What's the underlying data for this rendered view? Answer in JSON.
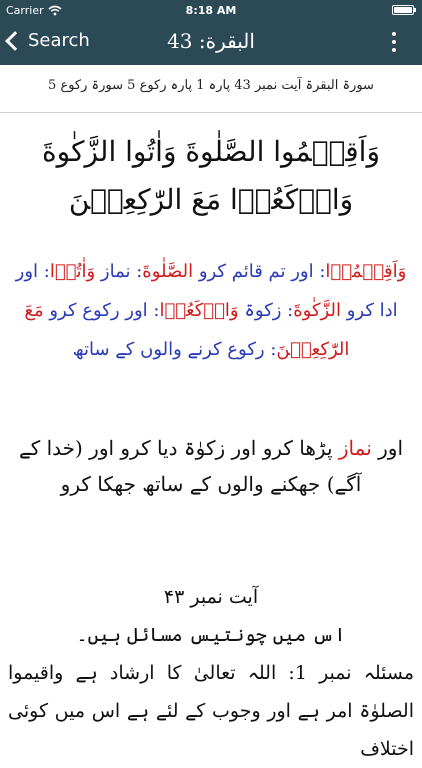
{
  "status": {
    "carrier": "Carrier",
    "time": "8:18 AM"
  },
  "nav": {
    "back_label": "Search",
    "title": "البقرة: 43"
  },
  "meta_line": "سورۃ البقرۃ آیت نمبر 43  پارہ 1 پارہ رکوع 5 سورۃ رکوع 5",
  "arabic_text": "وَاَقِيۡمُوا الصَّلٰوةَ وَاٰتُوا الزَّكٰوةَ وَارۡكَعُوۡا مَعَ الرّٰكِعِيۡنَ",
  "word_by_word": [
    {
      "arabic": "وَاَقِيۡمُوۡا",
      "urdu": "اور تم قائم کرو"
    },
    {
      "arabic": "الصَّلٰوةَ",
      "urdu": "نماز"
    },
    {
      "arabic": "وَاٰتُوۡا",
      "urdu": "اور ادا کرو"
    },
    {
      "arabic": "الزَّكٰوةَ",
      "urdu": "زکوۃ"
    },
    {
      "arabic": "وَارۡكَعُوۡا",
      "urdu": "اور رکوع کرو"
    },
    {
      "arabic": "مَعَ",
      "urdu": ""
    },
    {
      "arabic": "الرّٰكِعِيۡنَ",
      "urdu": "رکوع کرنے والوں کے ساتھ"
    }
  ],
  "translation": {
    "before": "اور ",
    "highlight": "نماز",
    "after": " پڑھا کرو اور زکوٰۃ دیا کرو اور (خدا کے آگے) جھکنے والوں کے ساتھ جھکا کرو"
  },
  "tafsir": {
    "heading": "آیت نمبر ۴۳",
    "intro": "اس میں چونتیس مسائل ہیں۔",
    "body": "مسئلہ نمبر 1: اللہ تعالیٰ کا ارشاد ہے واقیموا الصلوٰۃ امر ہے اور وجوب کے لئے ہے اس میں کوئی اختلاف"
  }
}
